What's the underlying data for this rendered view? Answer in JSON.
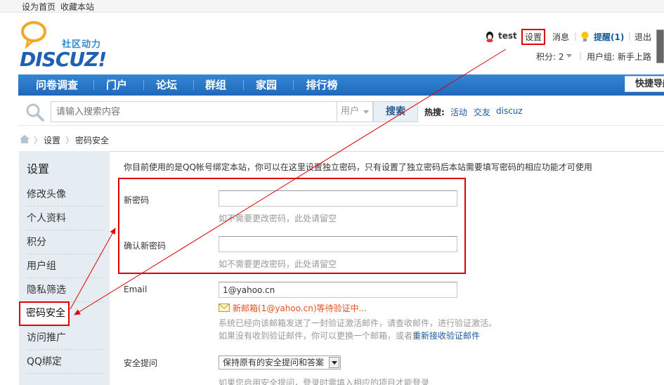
{
  "topbar": {
    "set_home": "设为首页",
    "bookmark": "收藏本站"
  },
  "logo": {
    "slogan": "社区动力",
    "word": "DISCUZ!"
  },
  "user": {
    "name": "test",
    "settings": "设置",
    "messages": "消息",
    "reminders": "提醒(1)",
    "logout": "退出",
    "points": "积分: 2",
    "usergroup": "用户组: 新手上路"
  },
  "nav": {
    "items": [
      "问卷调查",
      "门户",
      "论坛",
      "群组",
      "家园",
      "排行榜"
    ],
    "quick_nav": "快捷导航"
  },
  "search": {
    "placeholder": "请输入搜索内容",
    "type": "用户",
    "button": "搜索",
    "hot_label": "热搜:",
    "hot_terms": [
      "活动",
      "交友",
      "discuz"
    ]
  },
  "breadcrumb": [
    "设置",
    "密码安全"
  ],
  "sidebar": {
    "title": "设置",
    "items": [
      "修改头像",
      "个人资料",
      "积分",
      "用户组",
      "隐私筛选",
      "密码安全",
      "访问推广",
      "QQ绑定"
    ],
    "active": "密码安全"
  },
  "main": {
    "info": "你目前使用的是QQ帐号绑定本站，你可以在这里设置独立密码，只有设置了独立密码后本站需要填写密码的相应功能才可使用",
    "new_password_label": "新密码",
    "new_password_hint": "如不需要更改密码，此处请留空",
    "confirm_password_label": "确认新密码",
    "confirm_password_hint": "如不需要更改密码，此处请留空",
    "email_label": "Email",
    "email_value": "1@yahoo.cn",
    "verify_pending": "新邮箱(1@yahoo.cn)等待验证中...",
    "verify_note1": "系统已经向该邮箱发送了一封验证激活邮件，请查收邮件，进行验证激活。",
    "verify_note2_prefix": "如果没有收到验证邮件，你可以更换一个邮箱，或者",
    "verify_resend": "重新接收验证邮件",
    "question_label": "安全提问",
    "question_value": "保持原有的安全提问和答案",
    "question_hint": "如果您启用安全提问，登录时需填入相应的项目才能登录"
  },
  "colors": {
    "nav": "#2b7acd",
    "highlight": "#e00000",
    "link": "#1a5a9a",
    "sidebar": "#e5edf2"
  }
}
